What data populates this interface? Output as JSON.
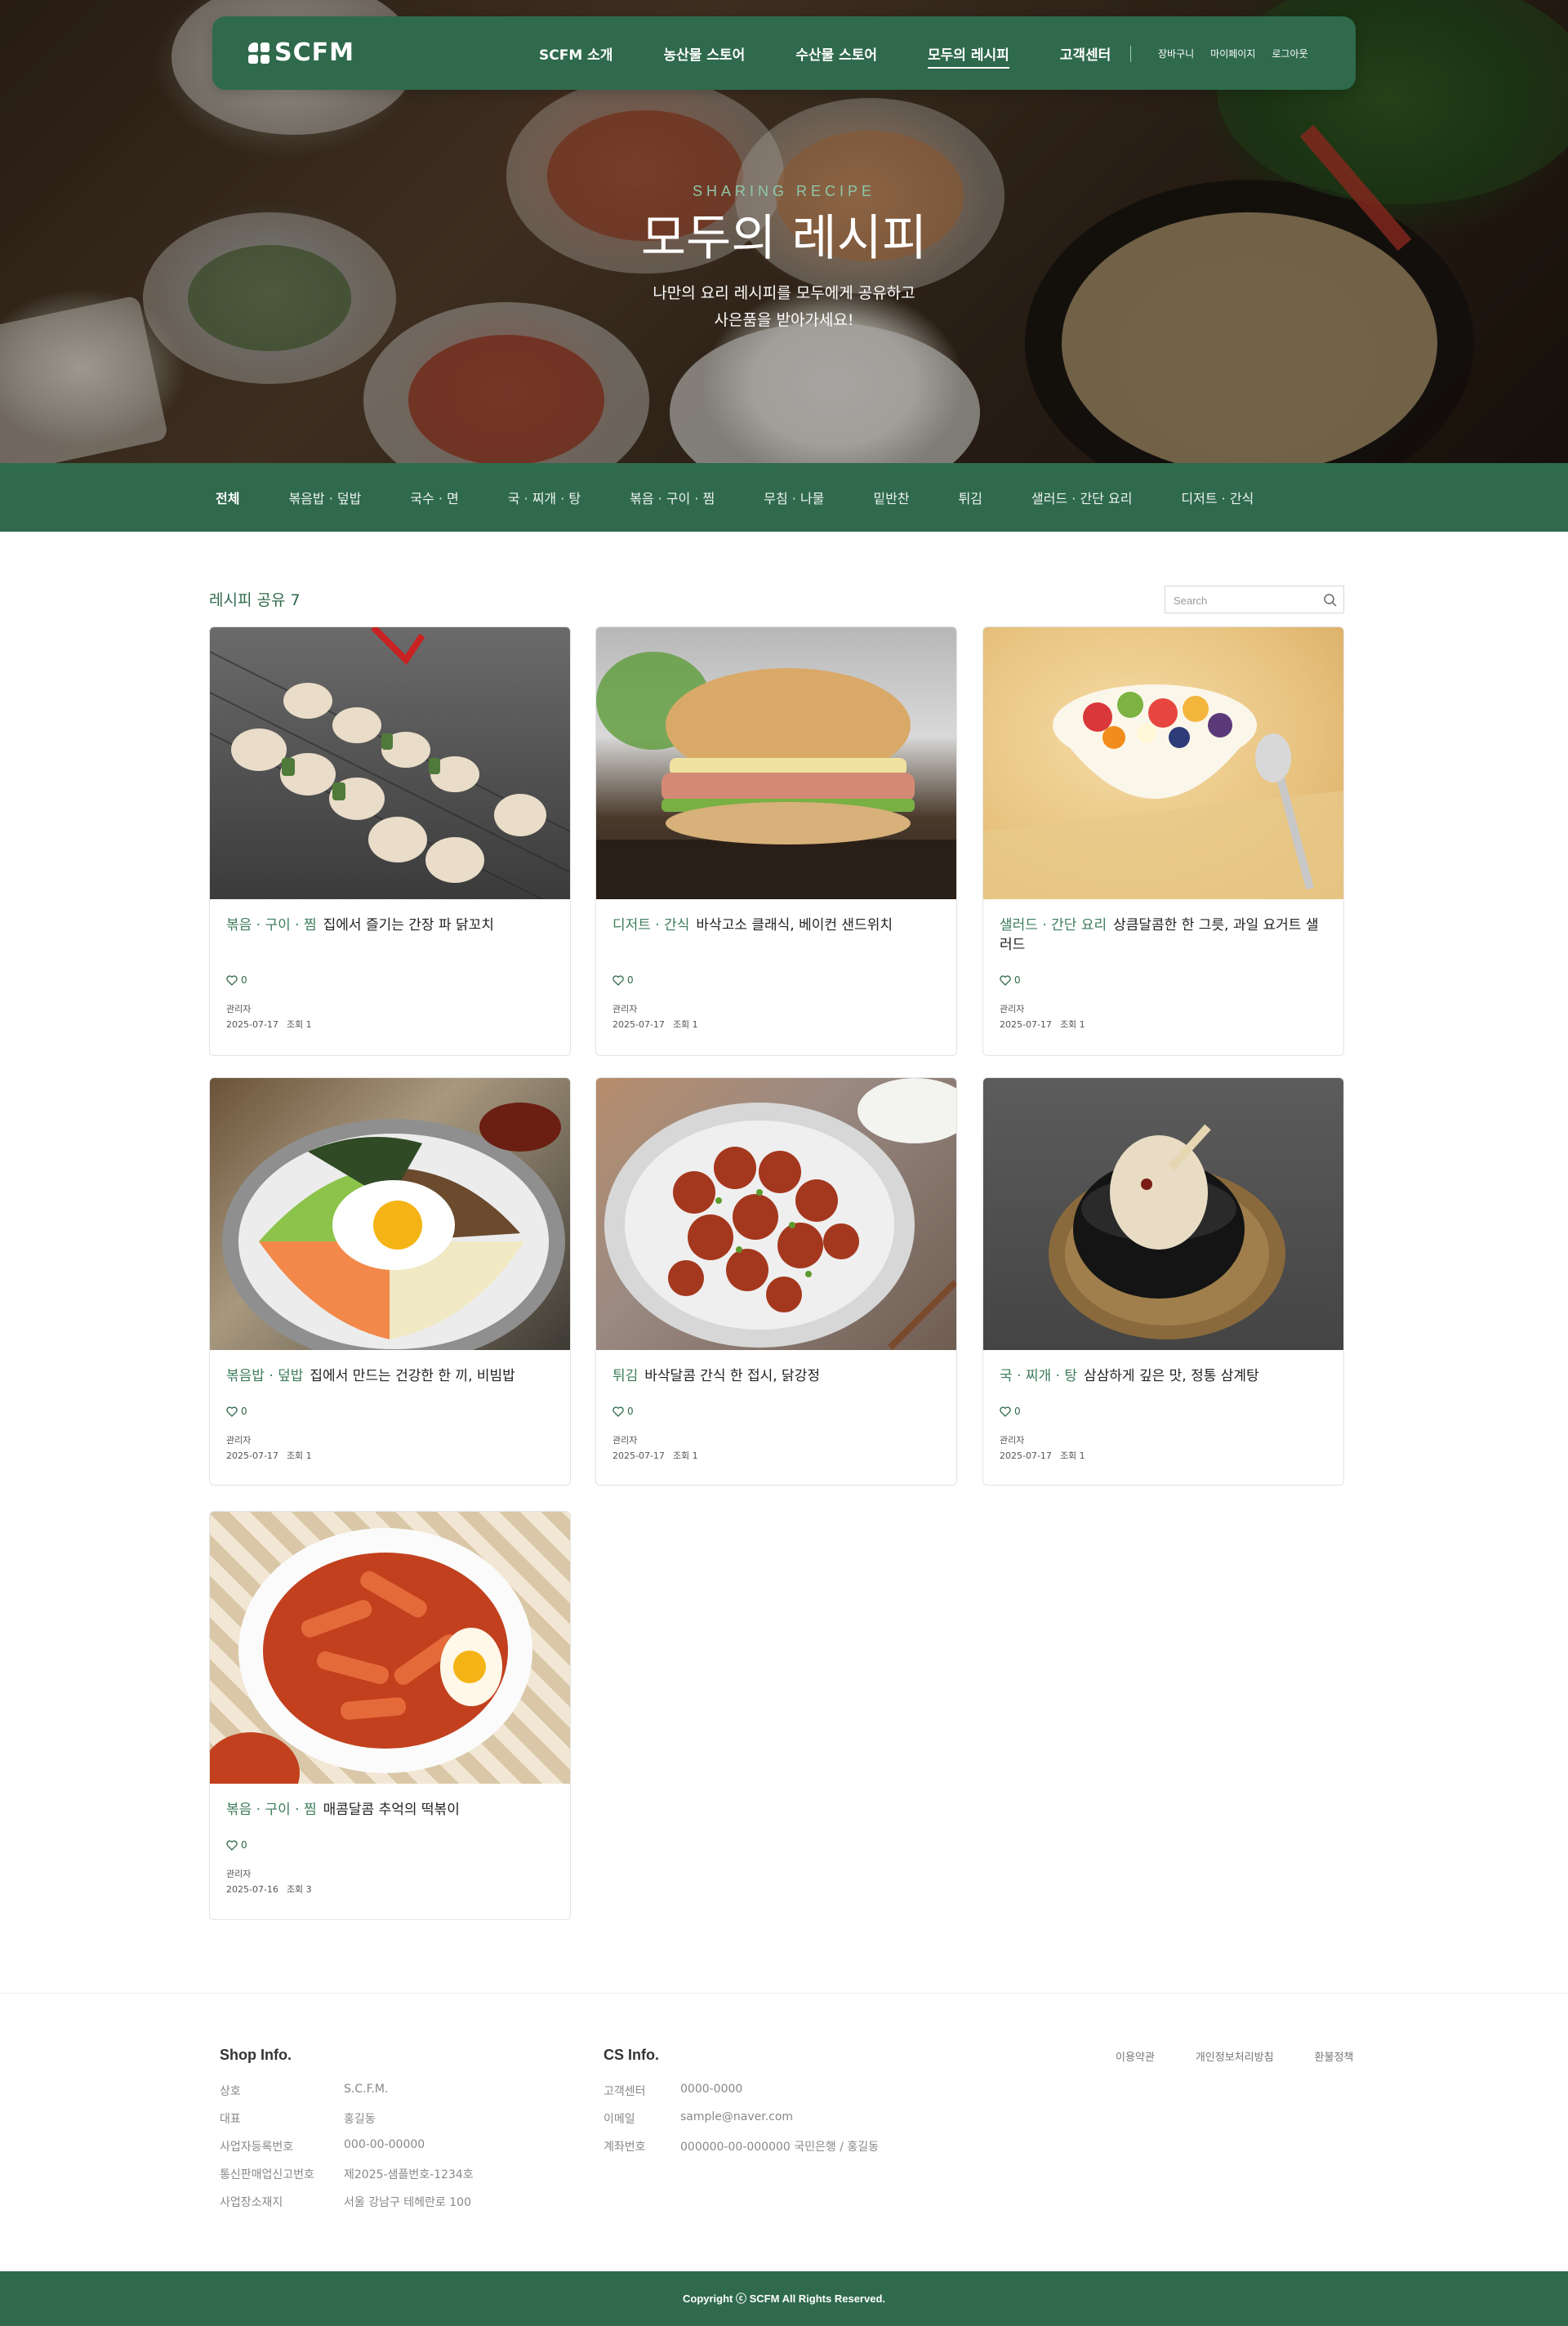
{
  "brand": {
    "name": "SCFM",
    "accent": "#2f6a4c"
  },
  "nav": {
    "items": [
      {
        "label": "SCFM 소개"
      },
      {
        "label": "농산물 스토어"
      },
      {
        "label": "수산물 스토어"
      },
      {
        "label": "모두의 레시피",
        "active": true
      },
      {
        "label": "고객센터"
      }
    ],
    "util": [
      "장바구니",
      "마이페이지",
      "로그아웃"
    ]
  },
  "hero": {
    "eyebrow": "SHARING RECIPE",
    "title": "모두의 레시피",
    "desc_line1": "나만의 요리 레시피를 모두에게 공유하고",
    "desc_line2": "사은품을 받아가세요!"
  },
  "categories": [
    "전체",
    "볶음밥 · 덮밥",
    "국수 · 면",
    "국 · 찌개 · 탕",
    "볶음 · 구이 · 찜",
    "무침 · 나물",
    "밑반찬",
    "튀김",
    "샐러드 · 간단 요리",
    "디저트 · 간식"
  ],
  "list": {
    "title": "레시피 공유 7",
    "search_placeholder": "Search"
  },
  "recipes": [
    {
      "category": "볶음 · 구이 · 찜",
      "title": "집에서 즐기는 간장 파 닭꼬치",
      "likes": "0",
      "author": "관리자",
      "date": "2025-07-17",
      "views": "조회 1",
      "image": "chicken-skewers"
    },
    {
      "category": "디저트 · 간식",
      "title": "바삭고소 클래식, 베이컨 샌드위치",
      "likes": "0",
      "author": "관리자",
      "date": "2025-07-17",
      "views": "조회 1",
      "image": "bacon-sandwich"
    },
    {
      "category": "샐러드 · 간단 요리",
      "title": "상큼달콤한 한 그릇, 과일 요거트 샐러드",
      "likes": "0",
      "author": "관리자",
      "date": "2025-07-17",
      "views": "조회 1",
      "image": "fruit-yogurt"
    },
    {
      "category": "볶음밥 · 덮밥",
      "title": "집에서 만드는 건강한 한 끼, 비빔밥",
      "likes": "0",
      "author": "관리자",
      "date": "2025-07-17",
      "views": "조회 1",
      "image": "bibimbap"
    },
    {
      "category": "튀김",
      "title": "바삭달콤 간식 한 접시, 닭강정",
      "likes": "0",
      "author": "관리자",
      "date": "2025-07-17",
      "views": "조회 1",
      "image": "dakgangjeong"
    },
    {
      "category": "국 · 찌개 · 탕",
      "title": "삼삼하게 깊은 맛, 정통 삼계탕",
      "likes": "0",
      "author": "관리자",
      "date": "2025-07-17",
      "views": "조회 1",
      "image": "samgyetang"
    },
    {
      "category": "볶음 · 구이 · 찜",
      "title": "매콤달콤 추억의 떡볶이",
      "likes": "0",
      "author": "관리자",
      "date": "2025-07-16",
      "views": "조회 3",
      "image": "tteokbokki"
    }
  ],
  "footer": {
    "shop_title": "Shop Info.",
    "shop_rows": [
      {
        "k": "상호",
        "v": "S.C.F.M."
      },
      {
        "k": "대표",
        "v": "홍길동"
      },
      {
        "k": "사업자등록번호",
        "v": "000-00-00000"
      },
      {
        "k": "통신판매업신고번호",
        "v": "제2025-샘플번호-1234호"
      },
      {
        "k": "사업장소재지",
        "v": "서울 강남구 테헤란로 100"
      }
    ],
    "cs_title": "CS Info.",
    "cs_rows": [
      {
        "k": "고객센터",
        "v": "0000-0000"
      },
      {
        "k": "이메일",
        "v": "sample@naver.com"
      },
      {
        "k": "계좌번호",
        "v": "000000-00-000000 국민은행 / 홍길동"
      }
    ],
    "links": [
      "이용약관",
      "개인정보처리방침",
      "환불정책"
    ],
    "copyright": "Copyright ⓒ SCFM All Rights Reserved."
  }
}
